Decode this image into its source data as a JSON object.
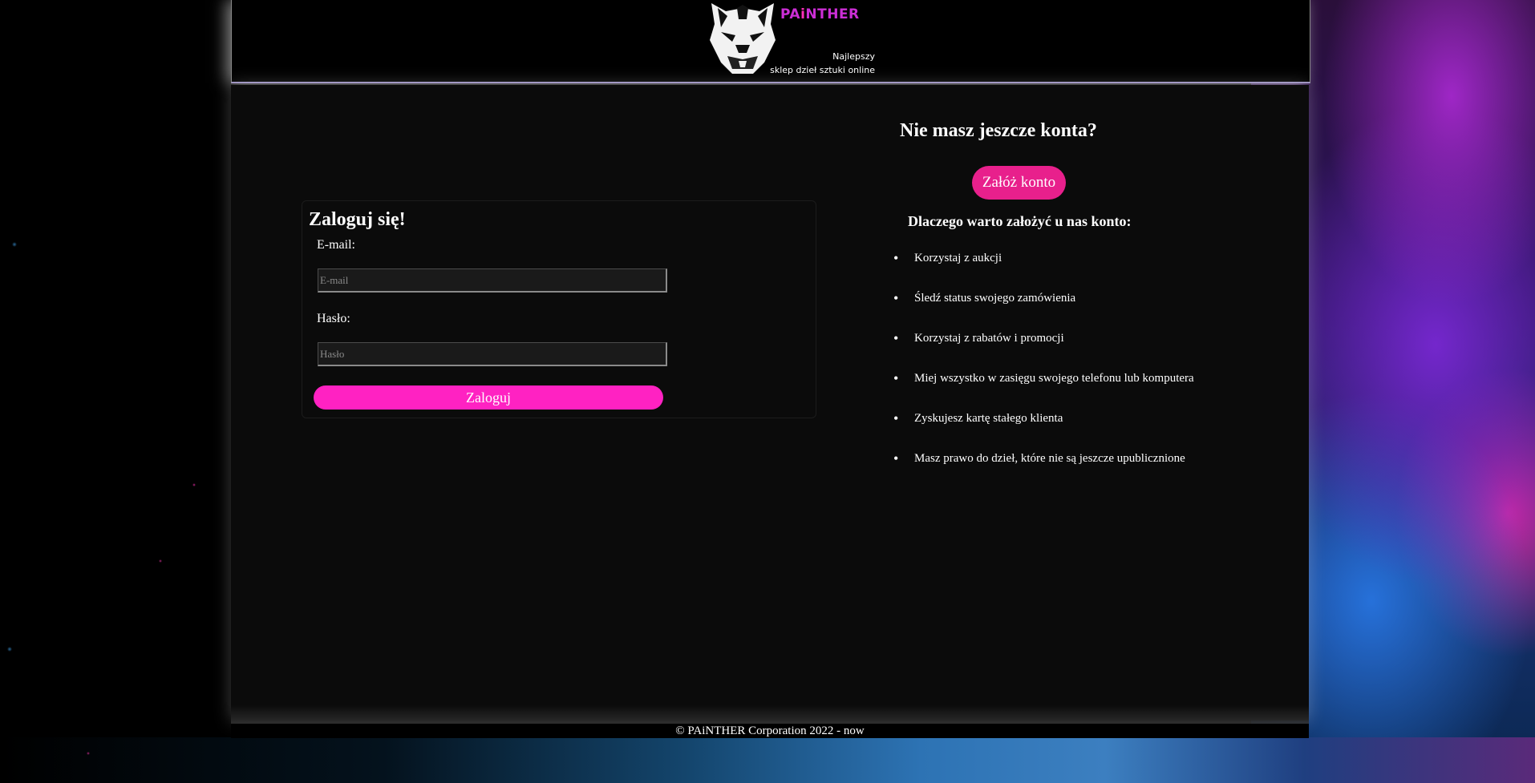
{
  "header": {
    "brand_prefix": "PA",
    "brand_i": "i",
    "brand_suffix": "NTHER",
    "tagline_line1": "Najlepszy",
    "tagline_line2": "sklep dzieł sztuki online",
    "logo_icon": "panther-head-icon"
  },
  "login": {
    "title": "Zaloguj się!",
    "email_label": "E-mail:",
    "email_placeholder": "E-mail",
    "password_label": "Hasło:",
    "password_placeholder": "Hasło",
    "submit_label": "Zaloguj"
  },
  "register": {
    "title": "Nie masz jeszcze konta?",
    "button_label": "Załóż konto",
    "why_title": "Dlaczego warto założyć u nas konto:",
    "benefits": [
      "Korzystaj z aukcji",
      "Śledź status swojego zamówienia",
      "Korzystaj z rabatów i promocji",
      "Miej wszystko w zasięgu swojego telefonu lub komputera",
      "Zyskujesz kartę stałego klienta",
      "Masz prawo do dzieł, które nie są jeszcze upublicznione"
    ]
  },
  "footer": {
    "text": "© PAiNTHER Corporation 2022 - now"
  },
  "colors": {
    "accent_pink": "#ff22c2",
    "register_pink": "#e8208c",
    "brand_purple": "#cc2ed6"
  }
}
